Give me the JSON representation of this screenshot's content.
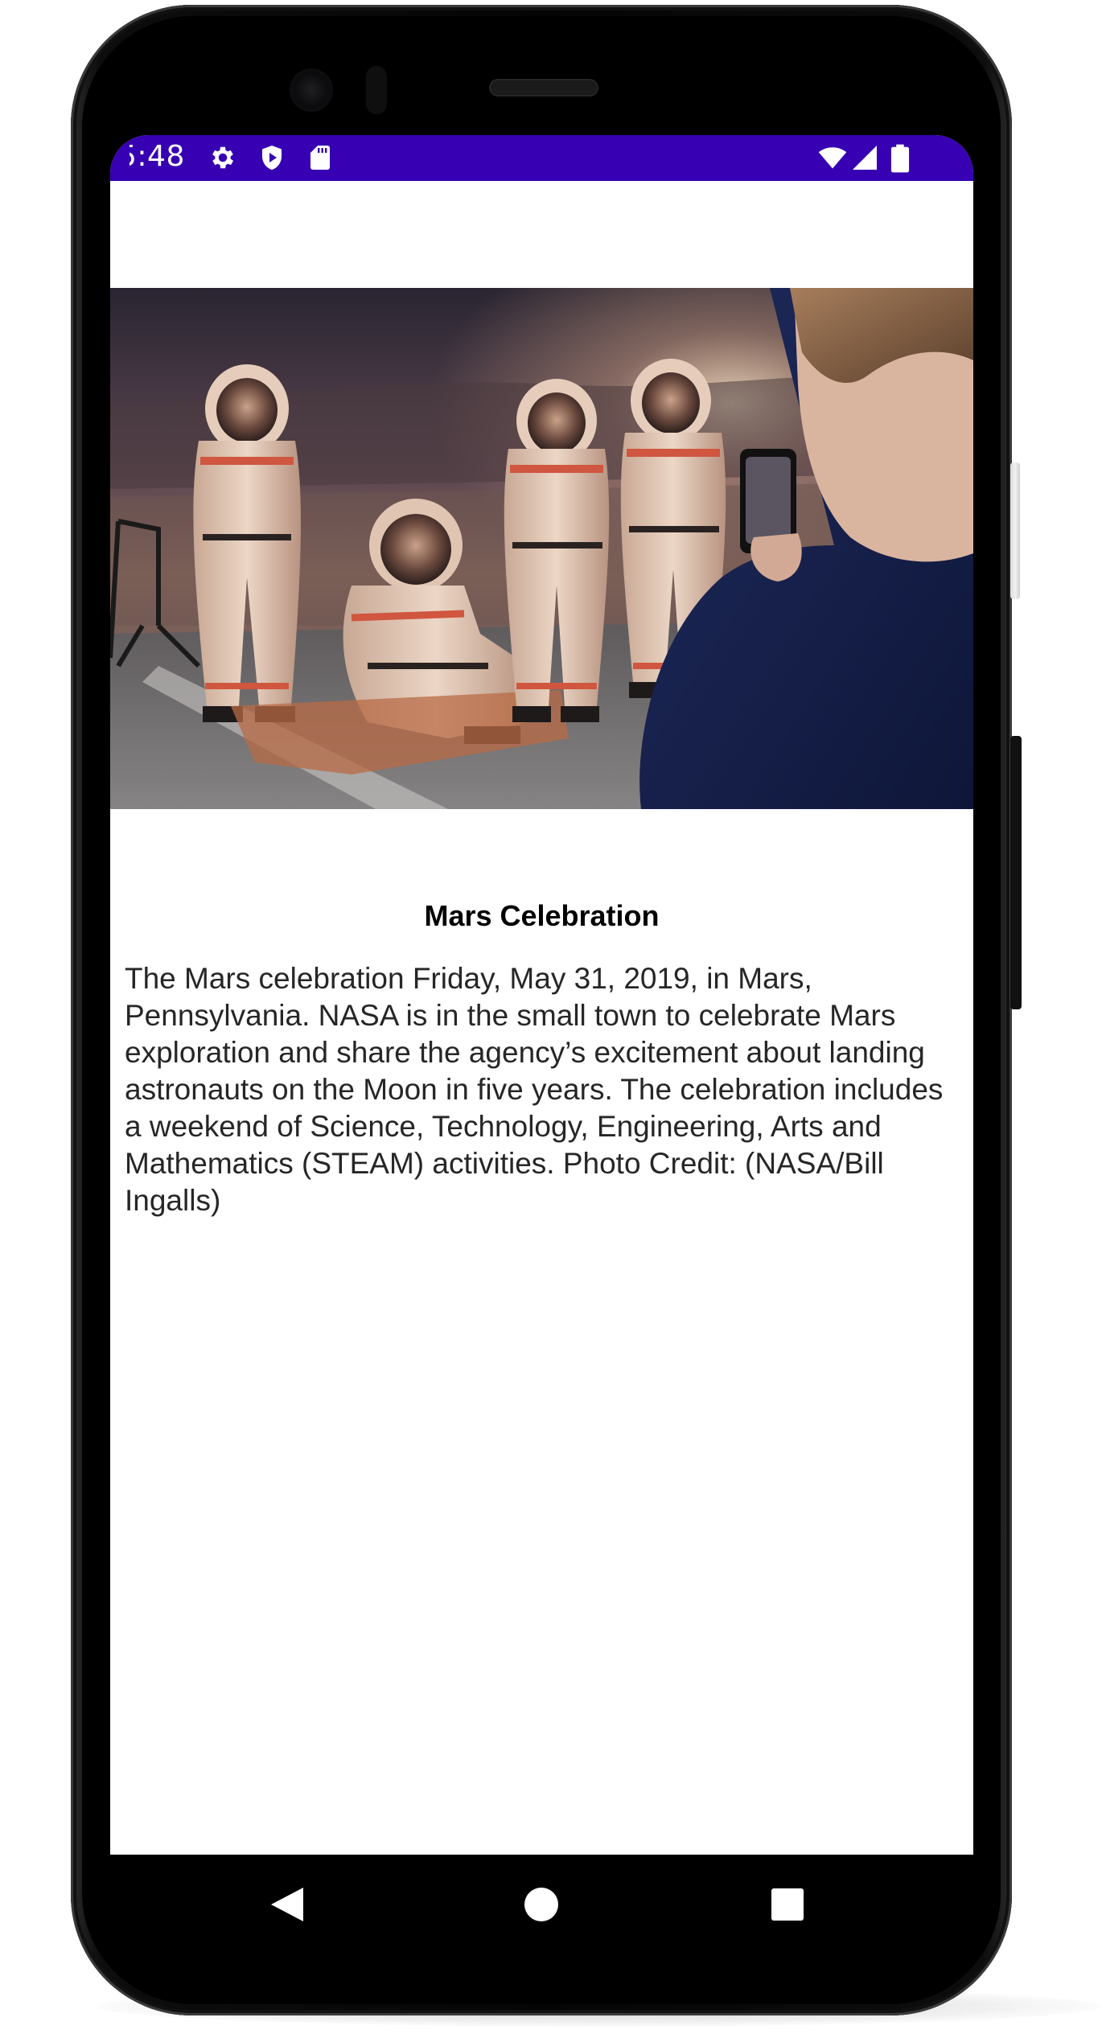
{
  "status_bar": {
    "time": "5:48",
    "left_icons": [
      "gear-icon",
      "shield-play-icon",
      "sd-card-icon"
    ],
    "right_icons": [
      "wifi-icon",
      "cell-signal-icon",
      "battery-icon"
    ],
    "background_color": "#3700b3"
  },
  "hero_image": {
    "alt": "Mars Celebration"
  },
  "article": {
    "title": "Mars Celebration",
    "description": "The Mars celebration Friday, May 31, 2019, in Mars, Pennsylvania. NASA is in the small town to celebrate Mars exploration and share the agency’s excitement about landing astronauts on the Moon in five years. The celebration includes a weekend of Science, Technology, Engineering, Arts and Mathematics (STEAM) activities. Photo Credit: (NASA/Bill Ingalls)"
  },
  "nav_bar": {
    "icons": [
      "back-icon",
      "home-icon",
      "recents-icon"
    ]
  },
  "colors": {
    "primary_dark": "#3700b3",
    "nav_bar": "#000000"
  }
}
